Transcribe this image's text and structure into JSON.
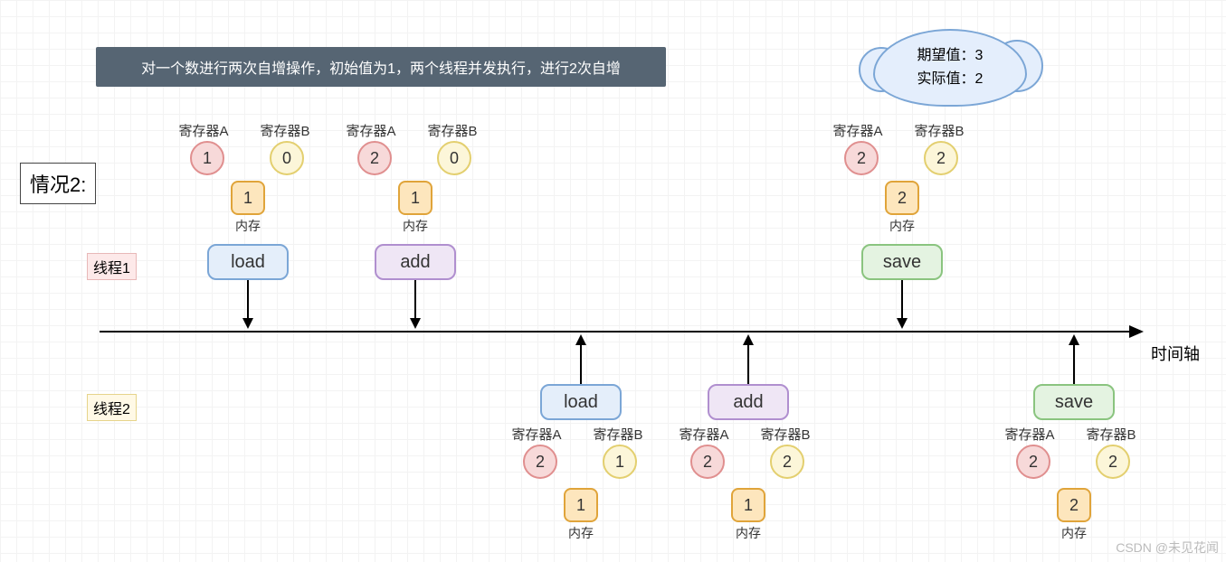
{
  "description": "对一个数进行两次自增操作，初始值为1，两个线程并发执行，进行2次自增",
  "case_label": "情况2:",
  "thread1_label": "线程1",
  "thread2_label": "线程2",
  "axis_label": "时间轴",
  "reg_a_label": "寄存器A",
  "reg_b_label": "寄存器B",
  "mem_label": "内存",
  "ops": {
    "load": "load",
    "add": "add",
    "save": "save"
  },
  "thread1_steps": [
    {
      "op": "load",
      "regA": "1",
      "regB": "0",
      "mem": "1"
    },
    {
      "op": "add",
      "regA": "2",
      "regB": "0",
      "mem": "1"
    },
    {
      "op": "save",
      "regA": "2",
      "regB": "2",
      "mem": "2"
    }
  ],
  "thread2_steps": [
    {
      "op": "load",
      "regA": "2",
      "regB": "1",
      "mem": "1"
    },
    {
      "op": "add",
      "regA": "2",
      "regB": "2",
      "mem": "1"
    },
    {
      "op": "save",
      "regA": "2",
      "regB": "2",
      "mem": "2"
    }
  ],
  "cloud": {
    "expected_label": "期望值：",
    "expected_val": "3",
    "actual_label": "实际值：",
    "actual_val": "2"
  },
  "watermark": "CSDN @未见花闻"
}
